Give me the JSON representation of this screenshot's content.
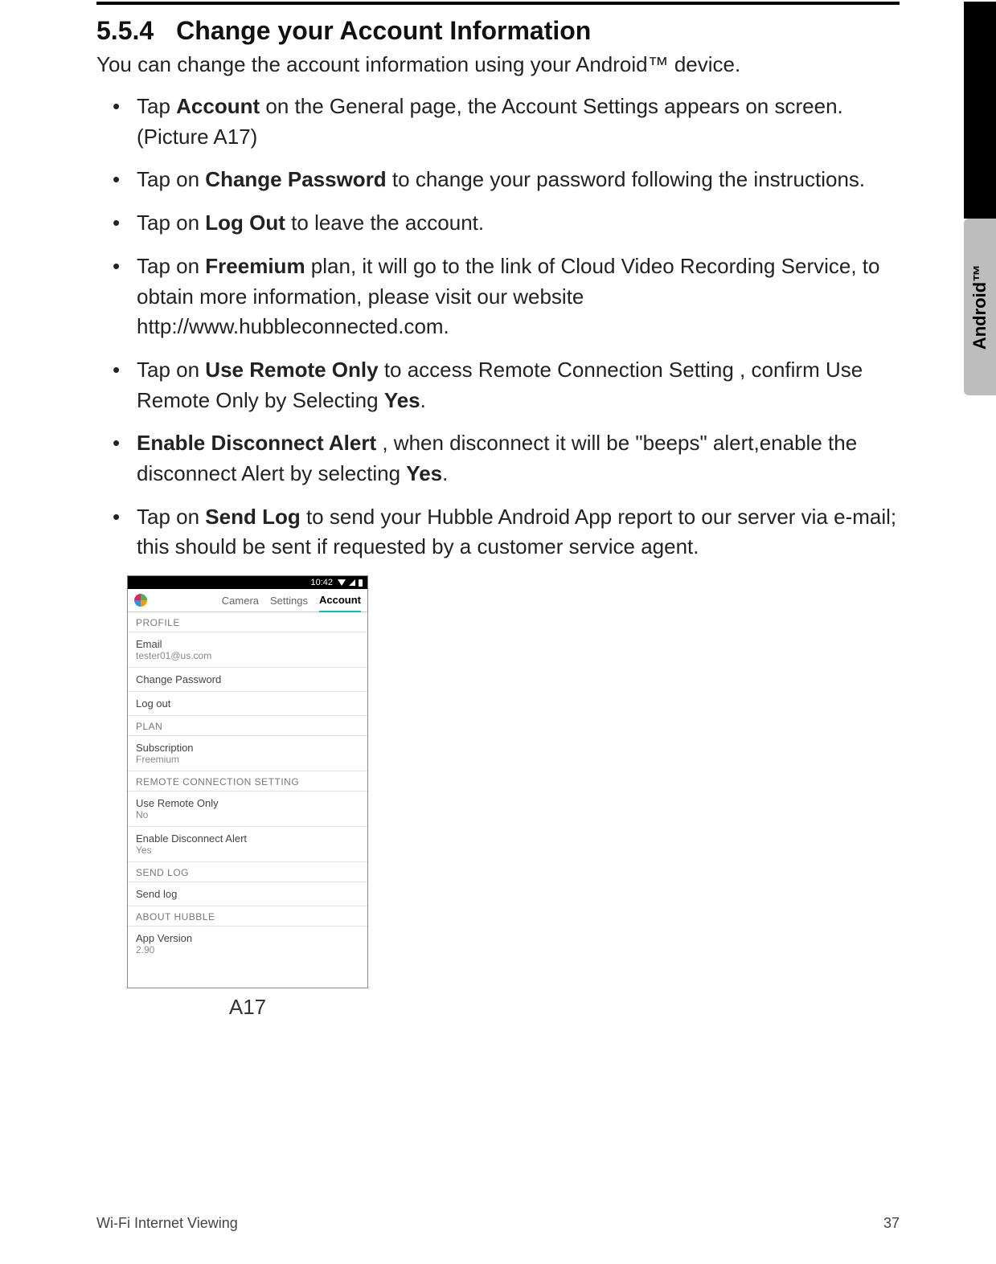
{
  "side_tab": "Android™",
  "heading": {
    "number": "5.5.4",
    "title": "Change your Account Information"
  },
  "intro": "You can change the account information using your Android™ device.",
  "bullets": [
    {
      "pre": "Tap ",
      "bold": "Account",
      "post": " on the General page, the Account Settings appears on screen. (Picture A17)"
    },
    {
      "pre": "Tap on ",
      "bold": "Change Password",
      "post": " to change your password following the instructions."
    },
    {
      "pre": "Tap on ",
      "bold": "Log Out",
      "post": " to leave the account."
    },
    {
      "pre": "Tap on ",
      "bold": "Freemium",
      "post": " plan, it will go to the link of Cloud Video Recording Service, to obtain more information, please visit our website http://www.hubbleconnected.com."
    },
    {
      "pre": "Tap on ",
      "bold": "Use Remote Only",
      "post": " to access Remote Connection Setting , confirm Use Remote Only by Selecting ",
      "bold2": "Yes",
      "post2": "."
    },
    {
      "bold": "Enable Disconnect Alert",
      "post": " , when disconnect it will be \"beeps\" alert,enable the disconnect Alert by selecting ",
      "bold2": "Yes",
      "post2": "."
    },
    {
      "pre": "Tap on ",
      "bold": "Send Log",
      "post": " to send your Hubble Android App report to our server via e-mail; this should be sent if requested by a customer service agent."
    }
  ],
  "screenshot": {
    "status_time": "10:42",
    "tabs": {
      "camera": "Camera",
      "settings": "Settings",
      "account": "Account"
    },
    "profile_hdr": "PROFILE",
    "email_label": "Email",
    "email_value": "tester01@us.com",
    "change_pw": "Change Password",
    "logout": "Log out",
    "plan_hdr": "PLAN",
    "sub_label": "Subscription",
    "sub_value": "Freemium",
    "remote_hdr": "REMOTE CONNECTION SETTING",
    "remote_label": "Use Remote Only",
    "remote_value": "No",
    "alert_label": "Enable Disconnect Alert",
    "alert_value": "Yes",
    "sendlog_hdr": "SEND LOG",
    "sendlog": "Send log",
    "about_hdr": "ABOUT HUBBLE",
    "ver_label": "App Version",
    "ver_value": "2.90"
  },
  "caption": "A17",
  "footer": {
    "left": "Wi-Fi Internet Viewing",
    "right": "37"
  }
}
